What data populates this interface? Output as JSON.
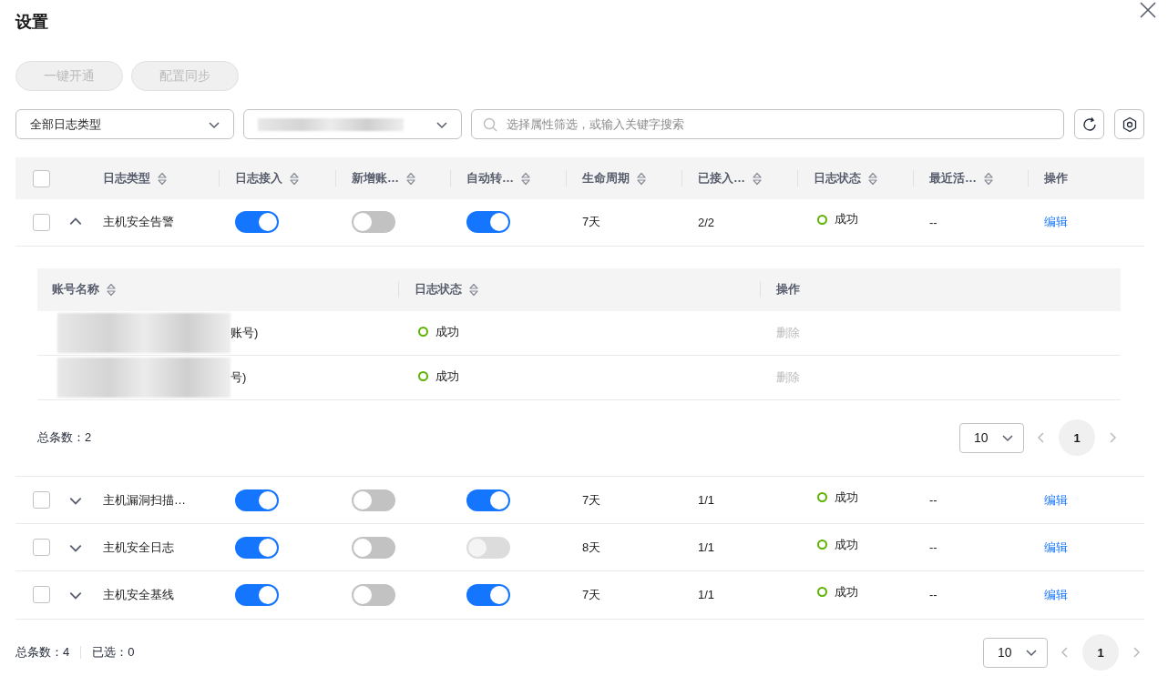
{
  "dialog": {
    "title": "设置"
  },
  "actions": [
    {
      "label": "一键开通",
      "disabled": true
    },
    {
      "label": "配置同步",
      "disabled": true
    }
  ],
  "filters": {
    "log_type_select": {
      "value": "全部日志类型"
    },
    "second_select": {
      "value_blurred": true
    },
    "search": {
      "placeholder": "选择属性筛选，或输入关键字搜索"
    }
  },
  "table": {
    "select_all": {
      "checked": false
    },
    "columns": [
      {
        "label": "日志类型",
        "sortable": true
      },
      {
        "label": "日志接入",
        "sortable": true
      },
      {
        "label": "新增账…",
        "sortable": true
      },
      {
        "label": "自动转…",
        "sortable": true
      },
      {
        "label": "生命周期",
        "sortable": true
      },
      {
        "label": "已接入…",
        "sortable": true
      },
      {
        "label": "日志状态",
        "sortable": true
      },
      {
        "label": "最近活…",
        "sortable": true
      },
      {
        "label": "操作",
        "sortable": false
      }
    ],
    "rows": [
      {
        "checked": false,
        "expanded": true,
        "name": "主机安全告警",
        "toggles": [
          {
            "on": true,
            "disabled": false
          },
          {
            "on": false,
            "disabled": false
          },
          {
            "on": true,
            "disabled": false
          }
        ],
        "lifecycle": "7天",
        "connected": "2/2",
        "status": "成功",
        "recent": "--",
        "action": "编辑",
        "detail": {
          "columns": [
            {
              "label": "账号名称",
              "sortable": true
            },
            {
              "label": "日志状态",
              "sortable": true
            },
            {
              "label": "操作",
              "sortable": false
            }
          ],
          "rows": [
            {
              "account": "账号)",
              "account_blurred": true,
              "status": "成功",
              "action": "删除",
              "action_disabled": true
            },
            {
              "account": "号)",
              "account_blurred": true,
              "status": "成功",
              "action": "删除",
              "action_disabled": true
            }
          ],
          "total": "总条数：2",
          "page_size": "10",
          "page": "1"
        }
      },
      {
        "checked": false,
        "expanded": false,
        "name": "主机漏洞扫描…",
        "toggles": [
          {
            "on": true,
            "disabled": false
          },
          {
            "on": false,
            "disabled": false
          },
          {
            "on": true,
            "disabled": false
          }
        ],
        "lifecycle": "7天",
        "connected": "1/1",
        "status": "成功",
        "recent": "--",
        "action": "编辑"
      },
      {
        "checked": false,
        "expanded": false,
        "name": "主机安全日志",
        "toggles": [
          {
            "on": true,
            "disabled": false
          },
          {
            "on": false,
            "disabled": false
          },
          {
            "on": false,
            "disabled": true
          }
        ],
        "lifecycle": "8天",
        "connected": "1/1",
        "status": "成功",
        "recent": "--",
        "action": "编辑"
      },
      {
        "checked": false,
        "expanded": false,
        "name": "主机安全基线",
        "toggles": [
          {
            "on": true,
            "disabled": false
          },
          {
            "on": false,
            "disabled": false
          },
          {
            "on": true,
            "disabled": false
          }
        ],
        "lifecycle": "7天",
        "connected": "1/1",
        "status": "成功",
        "recent": "--",
        "action": "编辑"
      }
    ]
  },
  "footer": {
    "total": "总条数：4",
    "selected": "已选：0",
    "page_size": "10",
    "page": "1"
  }
}
